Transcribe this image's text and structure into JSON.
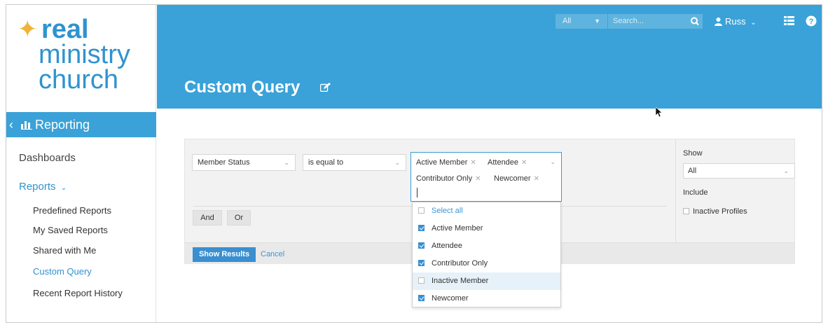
{
  "logo": {
    "line1": "real",
    "line2": "ministry",
    "line3": "church"
  },
  "sidebar": {
    "section": "Reporting",
    "dashboards": "Dashboards",
    "reports": "Reports",
    "items": [
      {
        "label": "Predefined Reports"
      },
      {
        "label": "My Saved Reports"
      },
      {
        "label": "Shared with Me"
      },
      {
        "label": "Custom Query"
      },
      {
        "label": "Recent Report History"
      }
    ]
  },
  "header": {
    "scope": "All",
    "search_placeholder": "Search...",
    "user": "Russ",
    "title": "Custom Query"
  },
  "filter": {
    "field": "Member Status",
    "operator": "is equal to",
    "tags": [
      "Active Member",
      "Attendee",
      "Contributor Only",
      "Newcomer"
    ],
    "and": "And",
    "or": "Or"
  },
  "dropdown": {
    "select_all": "Select all",
    "options": [
      {
        "label": "Active Member",
        "checked": true
      },
      {
        "label": "Attendee",
        "checked": true
      },
      {
        "label": "Contributor Only",
        "checked": true
      },
      {
        "label": "Inactive Member",
        "checked": false
      },
      {
        "label": "Newcomer",
        "checked": true
      }
    ]
  },
  "options_pane": {
    "show_label": "Show",
    "show_value": "All",
    "include_label": "Include",
    "inactive_profiles": "Inactive Profiles"
  },
  "actions": {
    "show_results": "Show Results",
    "cancel": "Cancel"
  },
  "colors": {
    "brand": "#3aa2d8",
    "accent": "#3a8fd0",
    "logo_star": "#f0b43a"
  }
}
